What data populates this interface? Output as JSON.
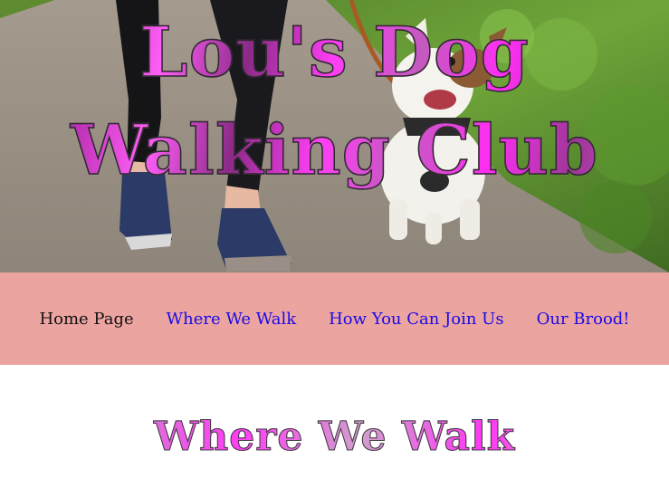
{
  "hero": {
    "title_line1": "Lou's Dog",
    "title_line2": "Walking Club",
    "image": "woman-jogging-with-jack-russell-terrier-photo"
  },
  "nav": {
    "items": [
      {
        "label": "Home Page",
        "current": true
      },
      {
        "label": "Where We Walk",
        "current": false
      },
      {
        "label": "How You Can Join Us",
        "current": false
      },
      {
        "label": "Our Brood!",
        "current": false
      }
    ]
  },
  "main": {
    "heading": "Where We Walk"
  },
  "colors": {
    "nav_background": "#eba4a0",
    "link": "#1a0ae6",
    "current_link": "#111111",
    "title_magenta": "#ff2df5"
  }
}
